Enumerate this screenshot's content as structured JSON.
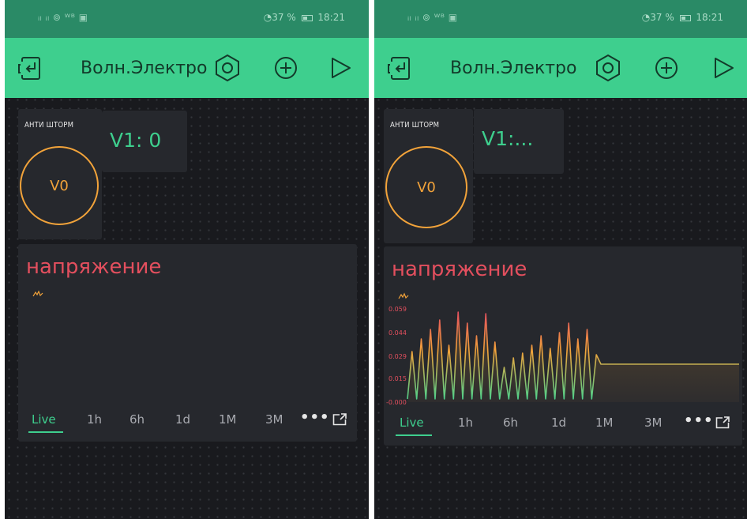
{
  "screens": [
    {
      "id": "left",
      "status_left": "ᵢₗ ᵢₗ ⊚ ᵂᴮ ▣",
      "status_battery": "◔37 %",
      "status_time": "18:21",
      "app_title": "Волн.Электро",
      "button_widget": {
        "title": "АНТИ ШТОРМ",
        "label": "V0"
      },
      "display_widget": {
        "value": "V1: 0"
      },
      "chart_widget": {
        "title": "напряжение",
        "tabs": [
          "Live",
          "1h",
          "6h",
          "1d",
          "1M",
          "3M"
        ],
        "active_tab": "Live",
        "more_label": "•••"
      }
    },
    {
      "id": "right",
      "status_left": "ᵢₗ ᵢₗ ⊚ ᵂᴮ ▣",
      "status_battery": "◔37 %",
      "status_time": "18:21",
      "app_title": "Волн.Электро",
      "button_widget": {
        "title": "АНТИ ШТОРМ",
        "label": "V0"
      },
      "display_widget": {
        "value": "V1:..."
      },
      "chart_widget": {
        "title": "напряжение",
        "tabs": [
          "Live",
          "1h",
          "6h",
          "1d",
          "1M",
          "3M"
        ],
        "active_tab": "Live",
        "more_label": "•••"
      }
    }
  ],
  "colors": {
    "status_bar": "#2a8a66",
    "toolbar": "#3ecf8e",
    "background": "#191a1e",
    "widget": "#26282d",
    "accent_orange": "#f2a33a",
    "accent_green": "#3ecf8e",
    "chart_title_red": "#e34f5e"
  },
  "icons": [
    "back-to-project-icon",
    "settings-hexagon-icon",
    "add-widget-plus-icon",
    "play-icon",
    "superchart-legend-icon",
    "chart-expand-icon"
  ],
  "chart_data": {
    "type": "line",
    "title": "напряжение",
    "xlabel": "",
    "ylabel": "",
    "ylim": [
      0,
      0.06
    ],
    "yticks": [
      "0.000",
      "0.015",
      "0.029",
      "0.044",
      "0.059"
    ],
    "x_range": "Live",
    "series": [
      {
        "values": [
          0.002,
          0.032,
          0.002,
          0.04,
          0.002,
          0.046,
          0.002,
          0.052,
          0.002,
          0.036,
          0.002,
          0.057,
          0.002,
          0.05,
          0.002,
          0.042,
          0.002,
          0.056,
          0.002,
          0.038,
          0.002,
          0.022,
          0.002,
          0.028,
          0.002,
          0.031,
          0.002,
          0.036,
          0.002,
          0.042,
          0.002,
          0.034,
          0.002,
          0.044,
          0.002,
          0.05,
          0.002,
          0.04,
          0.002,
          0.046,
          0.002,
          0.03,
          0.024,
          0.024,
          0.024,
          0.024,
          0.024,
          0.024,
          0.024,
          0.024,
          0.024,
          0.024,
          0.024,
          0.024,
          0.024,
          0.024,
          0.024,
          0.024,
          0.024,
          0.024,
          0.024,
          0.024,
          0.024,
          0.024,
          0.024,
          0.024,
          0.024,
          0.024,
          0.024,
          0.024,
          0.024,
          0.024,
          0.024
        ]
      }
    ]
  }
}
